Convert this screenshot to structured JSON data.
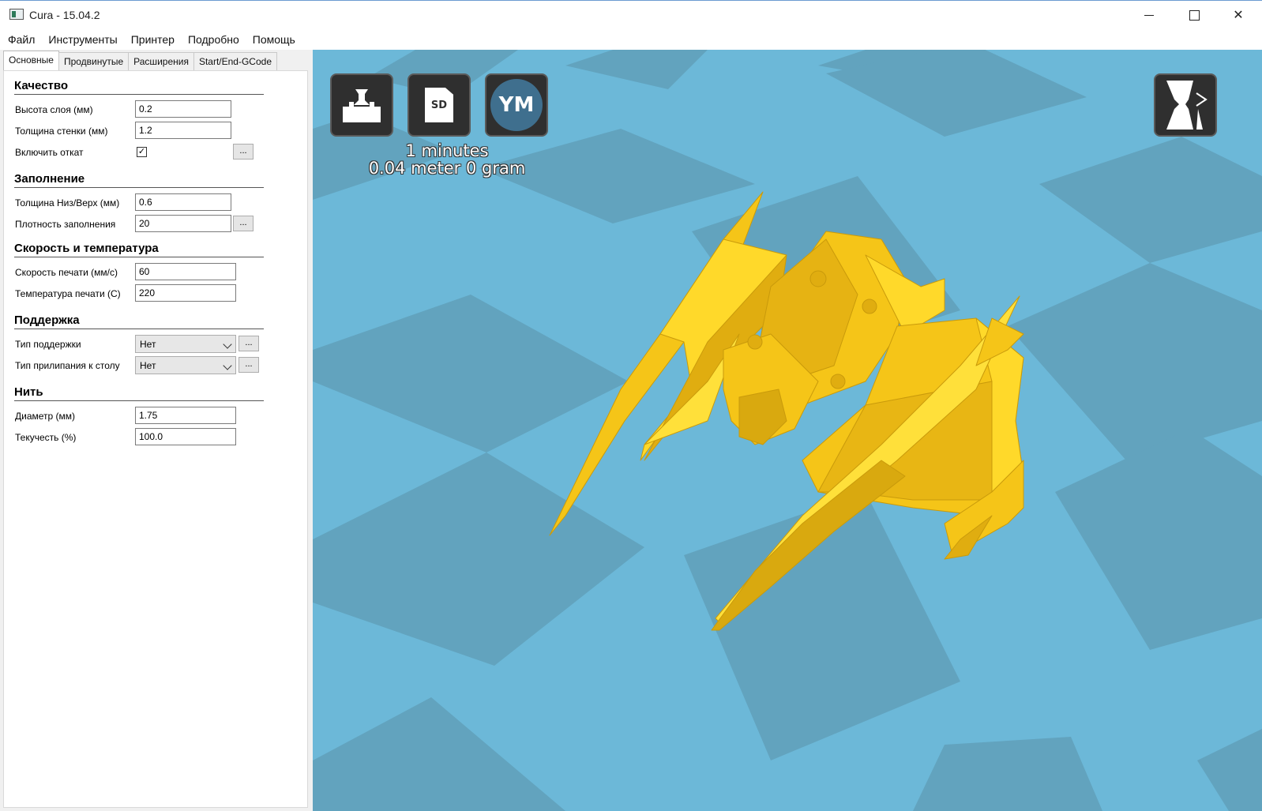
{
  "window": {
    "title": "Cura - 15.04.2",
    "minimize_glyph": "",
    "maximize_glyph": "",
    "close_glyph": "✕"
  },
  "menu": [
    "Файл",
    "Инструменты",
    "Принтер",
    "Подробно",
    "Помощь"
  ],
  "tabs": [
    "Основные",
    "Продвинутые",
    "Расширения",
    "Start/End-GCode"
  ],
  "active_tab": "Основные",
  "settings": {
    "quality": {
      "title": "Качество",
      "layer_height_label": "Высота слоя (мм)",
      "layer_height": "0.2",
      "shell_thickness_label": "Толщина стенки (мм)",
      "shell_thickness": "1.2",
      "retraction_label": "Включить откат",
      "retraction_checked": "✓",
      "retraction_more": "..."
    },
    "fill": {
      "title": "Заполнение",
      "bottom_top_label": "Толщина Низ/Верх (мм)",
      "bottom_top": "0.6",
      "density_label": "Плотность заполнения",
      "density": "20",
      "density_more": "..."
    },
    "speed": {
      "title": "Скорость и температура",
      "print_speed_label": "Скорость печати (мм/с)",
      "print_speed": "60",
      "print_temp_label": "Температура печати (C)",
      "print_temp": "220"
    },
    "support": {
      "title": "Поддержка",
      "support_type_label": "Тип поддержки",
      "support_type": "Нет",
      "support_more": "...",
      "adhesion_label": "Тип прилипания к столу",
      "adhesion": "Нет",
      "adhesion_more": "..."
    },
    "filament": {
      "title": "Нить",
      "diameter_label": "Диаметр (мм)",
      "diameter": "1.75",
      "flow_label": "Текучесть (%)",
      "flow": "100.0"
    }
  },
  "viewport": {
    "toolbar": {
      "load_icon": "load-model-icon",
      "sd_icon": "save-to-sd-icon",
      "sd_label": "SD",
      "ym_icon": "youmagine-icon",
      "ym_label": "YM",
      "view_mode_icon": "view-mode-icon"
    },
    "print_time": "1 minutes",
    "print_material": "0.04 meter 0 gram",
    "colors": {
      "floor_light": "#6cb8d8",
      "floor_dark": "#62a3be",
      "model": "#f5c518",
      "model_shade": "#d9a90f",
      "model_highlight": "#ffe03a"
    }
  }
}
